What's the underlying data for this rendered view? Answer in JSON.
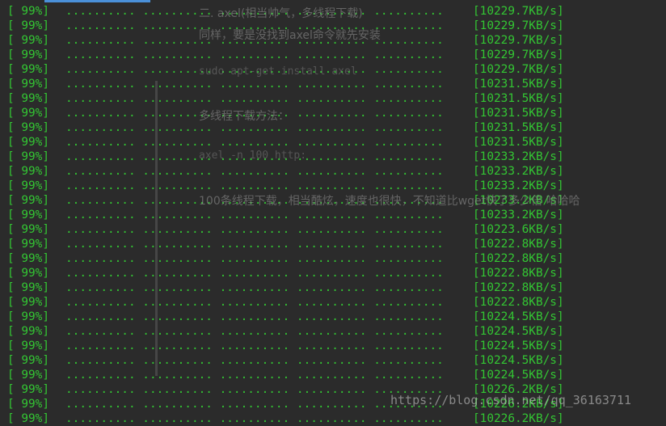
{
  "terminal": {
    "lines": [
      {
        "pct": "[ 99%]",
        "dots": ".......... .......... .......... .......... ..........",
        "speed": "[10229.7KB/s]"
      },
      {
        "pct": "[ 99%]",
        "dots": ".......... .......... .......... .......... ..........",
        "speed": "[10229.7KB/s]"
      },
      {
        "pct": "[ 99%]",
        "dots": ".......... .......... .......... .......... ..........",
        "speed": "[10229.7KB/s]"
      },
      {
        "pct": "[ 99%]",
        "dots": ".......... .......... .......... .......... ..........",
        "speed": "[10229.7KB/s]"
      },
      {
        "pct": "[ 99%]",
        "dots": ".......... .......... .......... .......... ..........",
        "speed": "[10229.7KB/s]"
      },
      {
        "pct": "[ 99%]",
        "dots": ".......... .......... .......... .......... ..........",
        "speed": "[10231.5KB/s]"
      },
      {
        "pct": "[ 99%]",
        "dots": ".......... .......... .......... .......... ..........",
        "speed": "[10231.5KB/s]"
      },
      {
        "pct": "[ 99%]",
        "dots": ".......... .......... .......... .......... ..........",
        "speed": "[10231.5KB/s]"
      },
      {
        "pct": "[ 99%]",
        "dots": ".......... .......... .......... .......... ..........",
        "speed": "[10231.5KB/s]"
      },
      {
        "pct": "[ 99%]",
        "dots": ".......... .......... .......... .......... ..........",
        "speed": "[10231.5KB/s]"
      },
      {
        "pct": "[ 99%]",
        "dots": ".......... .......... .......... .......... ..........",
        "speed": "[10233.2KB/s]"
      },
      {
        "pct": "[ 99%]",
        "dots": ".......... .......... .......... .......... ..........",
        "speed": "[10233.2KB/s]"
      },
      {
        "pct": "[ 99%]",
        "dots": ".......... .......... .......... .......... ..........",
        "speed": "[10233.2KB/s]"
      },
      {
        "pct": "[ 99%]",
        "dots": ".......... .......... .......... .......... ..........",
        "speed": "[10233.2KB/s]"
      },
      {
        "pct": "[ 99%]",
        "dots": ".......... .......... .......... .......... ..........",
        "speed": "[10233.2KB/s]"
      },
      {
        "pct": "[ 99%]",
        "dots": ".......... .......... .......... .......... ..........",
        "speed": "[10223.6KB/s]"
      },
      {
        "pct": "[ 99%]",
        "dots": ".......... .......... .......... .......... ..........",
        "speed": "[10222.8KB/s]"
      },
      {
        "pct": "[ 99%]",
        "dots": ".......... .......... .......... .......... ..........",
        "speed": "[10222.8KB/s]"
      },
      {
        "pct": "[ 99%]",
        "dots": ".......... .......... .......... .......... ..........",
        "speed": "[10222.8KB/s]"
      },
      {
        "pct": "[ 99%]",
        "dots": ".......... .......... .......... .......... ..........",
        "speed": "[10222.8KB/s]"
      },
      {
        "pct": "[ 99%]",
        "dots": ".......... .......... .......... .......... ..........",
        "speed": "[10222.8KB/s]"
      },
      {
        "pct": "[ 99%]",
        "dots": ".......... .......... .......... .......... ..........",
        "speed": "[10224.5KB/s]"
      },
      {
        "pct": "[ 99%]",
        "dots": ".......... .......... .......... .......... ..........",
        "speed": "[10224.5KB/s]"
      },
      {
        "pct": "[ 99%]",
        "dots": ".......... .......... .......... .......... ..........",
        "speed": "[10224.5KB/s]"
      },
      {
        "pct": "[ 99%]",
        "dots": ".......... .......... .......... .......... ..........",
        "speed": "[10224.5KB/s]"
      },
      {
        "pct": "[ 99%]",
        "dots": ".......... .......... .......... .......... ..........",
        "speed": "[10224.5KB/s]"
      },
      {
        "pct": "[ 99%]",
        "dots": ".......... .......... .......... .......... ..........",
        "speed": "[10226.2KB/s]"
      },
      {
        "pct": "[ 99%]",
        "dots": ".......... .......... .......... .......... ..........",
        "speed": "[10226.2KB/s]"
      },
      {
        "pct": "[ 99%]",
        "dots": ".......... .......... .......... .......... ..........",
        "speed": "[10226.2KB/s]"
      }
    ]
  },
  "overlay": {
    "heading": "二. axel(相当帅气，多线程下载)",
    "note": "同样，要是没找到axel命令就先安装",
    "install_cmd": "sudo apt-get install axel",
    "usage_title": "多线程下载方法：",
    "usage_cmd": "axel -n 100 http:",
    "comment": "100条线程下载，相当酷炫，速度也很快，不知道比wget快了多少倍 哈哈哈"
  },
  "watermark": "https://blog.csdn.net/qq_36163711",
  "colors": {
    "background": "#2b2b2b",
    "terminal_text": "#33c633",
    "tab_accent": "#4a90d9"
  }
}
